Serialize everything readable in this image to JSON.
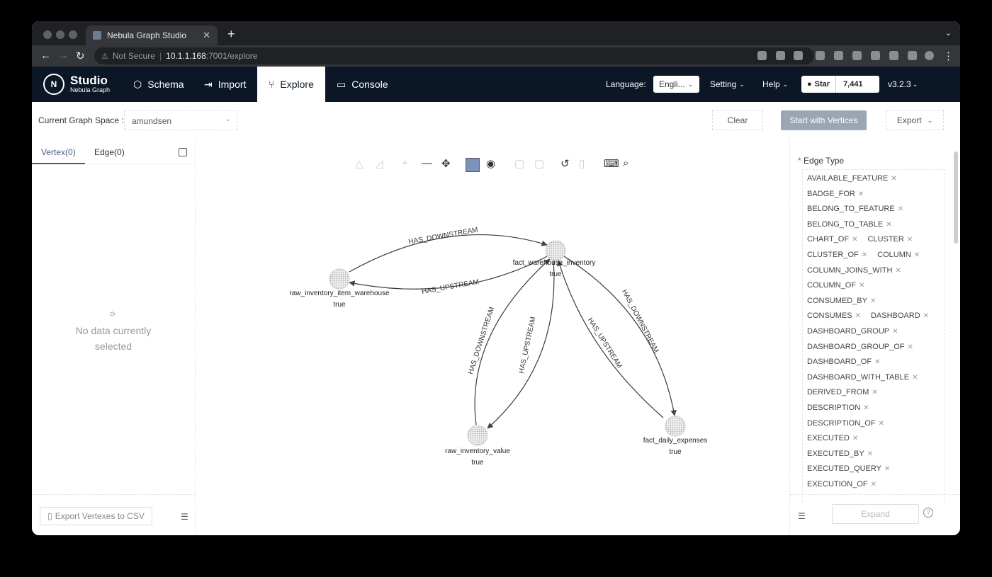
{
  "browser": {
    "tab_title": "Nebula Graph Studio",
    "security_label": "Not Secure",
    "url_host": "10.1.1.168",
    "url_rest": ":7001/explore"
  },
  "app": {
    "logo_title": "Studio",
    "logo_subtitle": "Nebula Graph",
    "nav": [
      {
        "label": "Schema",
        "icon": "schema-icon"
      },
      {
        "label": "Import",
        "icon": "import-icon"
      },
      {
        "label": "Explore",
        "icon": "explore-icon"
      },
      {
        "label": "Console",
        "icon": "console-icon"
      }
    ],
    "language_label": "Language:",
    "language_value": "Engli...",
    "setting_label": "Setting",
    "help_label": "Help",
    "github_star_label": "Star",
    "github_star_count": "7,441",
    "version": "v3.2.3"
  },
  "toolbar": {
    "graph_space_label": "Current Graph Space :",
    "graph_space_value": "amundsen",
    "clear_label": "Clear",
    "start_label": "Start with Vertices",
    "export_label": "Export"
  },
  "left_panel": {
    "tab_vertex": "Vertex(0)",
    "tab_edge": "Edge(0)",
    "empty_line1": "No data currently",
    "empty_line2": "selected",
    "export_csv_label": "Export Vertexes to CSV"
  },
  "graph": {
    "nodes": [
      {
        "id": "n1",
        "label": "fact_warehouse_inventory",
        "sub": "true"
      },
      {
        "id": "n2",
        "label": "raw_inventory_item_warehouse",
        "sub": "true"
      },
      {
        "id": "n3",
        "label": "raw_inventory_value",
        "sub": "true"
      },
      {
        "id": "n4",
        "label": "fact_daily_expenses",
        "sub": "true"
      }
    ],
    "edges": [
      {
        "label": "HAS_DOWNSTREAM",
        "from": "n2",
        "to": "n1"
      },
      {
        "label": "HAS_UPSTREAM",
        "from": "n1",
        "to": "n2"
      },
      {
        "label": "HAS_DOWNSTREAM",
        "from": "n3",
        "to": "n1"
      },
      {
        "label": "HAS_UPSTREAM",
        "from": "n1",
        "to": "n3"
      },
      {
        "label": "HAS_UPSTREAM",
        "from": "n4",
        "to": "n1"
      },
      {
        "label": "HAS_DOWNSTREAM",
        "from": "n1",
        "to": "n4"
      }
    ]
  },
  "right_panel": {
    "edge_type_title": "Edge Type",
    "edge_types": [
      "AVAILABLE_FEATURE",
      "BADGE_FOR",
      "BELONG_TO_FEATURE",
      "BELONG_TO_TABLE",
      "CHART_OF",
      "CLUSTER",
      "CLUSTER_OF",
      "COLUMN",
      "COLUMN_JOINS_WITH",
      "COLUMN_OF",
      "CONSUMED_BY",
      "CONSUMES",
      "DASHBOARD",
      "DASHBOARD_GROUP",
      "DASHBOARD_GROUP_OF",
      "DASHBOARD_OF",
      "DASHBOARD_WITH_TABLE",
      "DERIVED_FROM",
      "DESCRIPTION",
      "DESCRIPTION_OF",
      "EXECUTED",
      "EXECUTED_BY",
      "EXECUTED_QUERY",
      "EXECUTION_OF"
    ],
    "expand_label": "Expand"
  }
}
